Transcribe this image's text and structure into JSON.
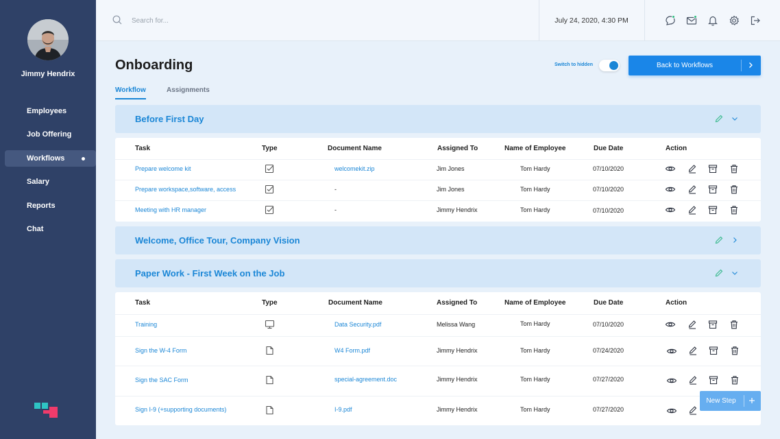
{
  "sidebar": {
    "user_name": "Jimmy Hendrix",
    "items": [
      {
        "label": "Employees",
        "active": false
      },
      {
        "label": "Job Offering",
        "active": false
      },
      {
        "label": "Workflows",
        "active": true
      },
      {
        "label": "Salary",
        "active": false
      },
      {
        "label": "Reports",
        "active": false
      },
      {
        "label": "Chat",
        "active": false
      }
    ]
  },
  "topbar": {
    "search_placeholder": "Search for...",
    "datetime": "July 24, 2020, 4:30 PM",
    "icons": [
      "chat-icon",
      "mail-icon",
      "bell-icon",
      "gear-icon",
      "logout-icon"
    ]
  },
  "page": {
    "title": "Onboarding",
    "switch_label": "Switch to hidden",
    "back_button": "Back to Workflows",
    "tabs": [
      "Workflow",
      "Assignments"
    ],
    "new_step_button": "New Step"
  },
  "columns": [
    "Task",
    "Type",
    "Document Name",
    "Assigned To",
    "Name of Employee",
    "Due Date",
    "Action"
  ],
  "sections": [
    {
      "title": "Before First Day",
      "expanded": true,
      "rows": [
        {
          "task": "Prepare welcome kit",
          "type": "checkbox",
          "document": "welcomekit.zip",
          "assigned_to": "Jim Jones",
          "employee": "Tom Hardy",
          "due": "07/10/2020"
        },
        {
          "task": "Prepare workspace,software, access",
          "type": "checkbox",
          "document": "-",
          "assigned_to": "Jim Jones",
          "employee": "Tom Hardy",
          "due": "07/10/2020"
        },
        {
          "task": "Meeting with HR manager",
          "type": "checkbox",
          "document": "-",
          "assigned_to": "Jimmy Hendrix",
          "employee": "Tom Hardy",
          "due": "07/10/2020"
        }
      ]
    },
    {
      "title": "Welcome, Office Tour, Company Vision",
      "expanded": false,
      "rows": []
    },
    {
      "title": "Paper Work - First Week on the Job",
      "expanded": true,
      "rows": [
        {
          "task": "Training",
          "type": "monitor",
          "document": "Data Security.pdf",
          "assigned_to": "Melissa Wang",
          "employee": "Tom Hardy",
          "due": "07/10/2020"
        },
        {
          "task": "Sign the W-4 Form",
          "type": "file",
          "document": "W4 Form.pdf",
          "assigned_to": "Jimmy Hendrix",
          "employee": "Tom Hardy",
          "due": "07/24/2020"
        },
        {
          "task": "Sign the SAC Form",
          "type": "file",
          "document": "special-agreement.doc",
          "assigned_to": "Jimmy Hendrix",
          "employee": "Tom Hardy",
          "due": "07/27/2020"
        },
        {
          "task": "Sign I-9 (+supporting documents)",
          "type": "file",
          "document": "I-9.pdf",
          "assigned_to": "Jimmy Hendrix",
          "employee": "Tom Hardy",
          "due": "07/27/2020"
        }
      ]
    }
  ],
  "colors": {
    "sidebar": "#2f4167",
    "accent": "#1a86d6",
    "section_bg": "#d3e6f8",
    "page_bg": "#e8f1fa",
    "badge": "#2dbe7f"
  }
}
